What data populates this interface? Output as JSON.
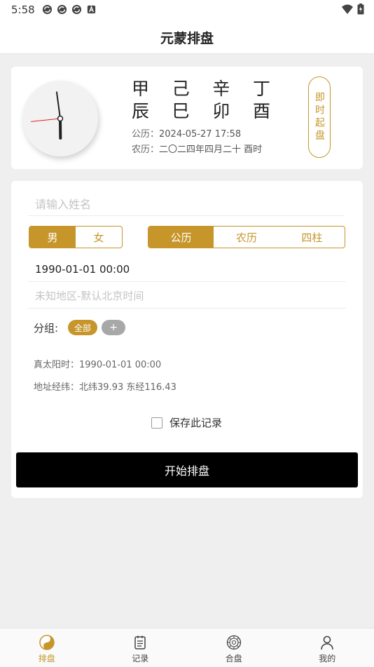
{
  "status_bar": {
    "time": "5:58",
    "left_icons": [
      "sync-icon",
      "sync-icon",
      "sync-icon",
      "a-icon"
    ],
    "right_icons": [
      "wifi-icon",
      "battery-icon"
    ]
  },
  "app_bar": {
    "title": "元蒙排盘"
  },
  "bazi_card": {
    "clock": {
      "hour": 5,
      "minute": 58,
      "second": 44
    },
    "heavenly_stems": [
      "甲",
      "己",
      "辛",
      "丁"
    ],
    "earthly_branches": [
      "辰",
      "巳",
      "卯",
      "酉"
    ],
    "solar_label": "公历：",
    "solar_value": "2024-05-27 17:58",
    "lunar_label": "农历：",
    "lunar_value": "二〇二四年四月二十 酉时",
    "instant_button": "即时起盘"
  },
  "form": {
    "name_placeholder": "请输入姓名",
    "gender_options": [
      "男",
      "女"
    ],
    "gender_selected": "男",
    "calendar_options": [
      "公历",
      "农历",
      "四柱"
    ],
    "calendar_selected": "公历",
    "birth_datetime": "1990-01-01 00:00",
    "location_placeholder": "未知地区-默认北京时间",
    "group_label": "分组:",
    "group_chip_all": "全部",
    "group_chip_add": "+",
    "true_solar_label": "真太阳时：",
    "true_solar_value": "1990-01-01 00:00",
    "coords_label": "地址经纬：",
    "coords_value": "北纬39.93 东经116.43",
    "save_label": "保存此记录",
    "save_checked": false,
    "start_button": "开始排盘"
  },
  "bottom_nav": [
    {
      "label": "排盘",
      "icon": "yin-yang-icon",
      "active": true
    },
    {
      "label": "记录",
      "icon": "notebook-icon",
      "active": false
    },
    {
      "label": "合盘",
      "icon": "compass-icon",
      "active": false
    },
    {
      "label": "我的",
      "icon": "person-icon",
      "active": false
    }
  ],
  "colors": {
    "accent": "#c6962b",
    "start_button_bg": "#000000",
    "page_bg": "#efefef"
  }
}
